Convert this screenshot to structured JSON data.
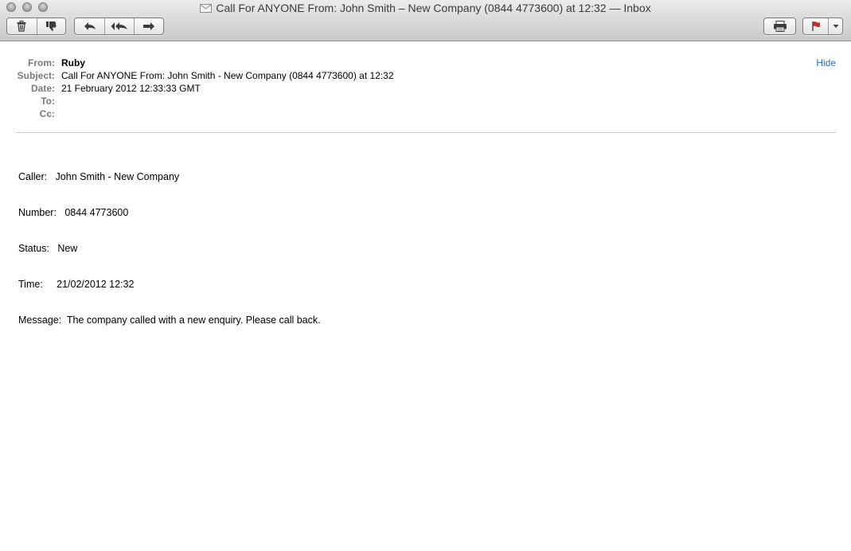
{
  "window": {
    "title": "Call For ANYONE From: John Smith – New Company  (0844 4773600) at  12:32 — Inbox"
  },
  "toolbar": {
    "delete_icon": "trash-icon",
    "junk_icon": "thumbs-down-icon",
    "reply_icon": "reply-arrow-icon",
    "reply_all_icon": "reply-all-arrow-icon",
    "forward_icon": "forward-arrow-icon",
    "print_icon": "printer-icon",
    "flag_icon": "flag-icon",
    "flag_color": "#d0282d"
  },
  "headers": {
    "from_label": "From:",
    "from_value": "Ruby",
    "subject_label": "Subject:",
    "subject_value": "Call For ANYONE From: John Smith - New Company  (0844 4773600) at  12:32",
    "date_label": "Date:",
    "date_value": "21 February 2012 12:33:33 GMT",
    "to_label": "To:",
    "to_value": "",
    "cc_label": "Cc:",
    "cc_value": "",
    "hide_label": "Hide"
  },
  "body": {
    "lines": [
      "Caller:   John Smith - New Company",
      "Number:   0844 4773600",
      "Status:   New",
      "Time:     21/02/2012 12:32",
      "Message:  The company called with a new enquiry. Please call back."
    ]
  }
}
